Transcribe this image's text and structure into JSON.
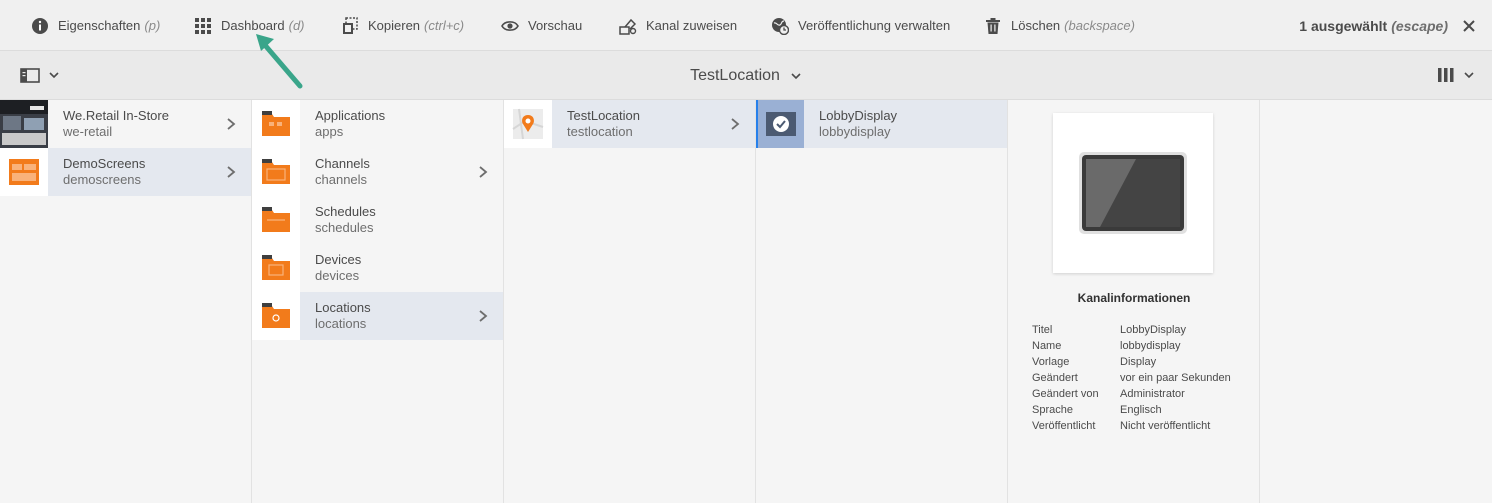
{
  "toolbar": {
    "properties": {
      "label": "Eigenschaften",
      "hint": "(p)"
    },
    "dashboard": {
      "label": "Dashboard",
      "hint": "(d)"
    },
    "copy": {
      "label": "Kopieren",
      "hint": "(ctrl+c)"
    },
    "preview": {
      "label": "Vorschau"
    },
    "assign_channel": {
      "label": "Kanal zuweisen"
    },
    "manage_publication": {
      "label": "Veröffentlichung verwalten"
    },
    "delete": {
      "label": "Löschen",
      "hint": "(backspace)"
    },
    "selection": {
      "label": "1 ausgewählt",
      "hint": "(escape)"
    }
  },
  "title": "TestLocation",
  "columns": {
    "col1": [
      {
        "title": "We.Retail In-Store",
        "sub": "we-retail"
      },
      {
        "title": "DemoScreens",
        "sub": "demoscreens"
      }
    ],
    "col2": [
      {
        "title": "Applications",
        "sub": "apps"
      },
      {
        "title": "Channels",
        "sub": "channels"
      },
      {
        "title": "Schedules",
        "sub": "schedules"
      },
      {
        "title": "Devices",
        "sub": "devices"
      },
      {
        "title": "Locations",
        "sub": "locations"
      }
    ],
    "col3": [
      {
        "title": "TestLocation",
        "sub": "testlocation"
      }
    ],
    "col4": [
      {
        "title": "LobbyDisplay",
        "sub": "lobbydisplay"
      }
    ]
  },
  "detail": {
    "heading": "Kanalinformationen",
    "props": [
      {
        "k": "Titel",
        "v": "LobbyDisplay"
      },
      {
        "k": "Name",
        "v": "lobbydisplay"
      },
      {
        "k": "Vorlage",
        "v": "Display"
      },
      {
        "k": "Geändert",
        "v": "vor ein paar Sekunden"
      },
      {
        "k": "Geändert von",
        "v": "Administrator"
      },
      {
        "k": "Sprache",
        "v": "Englisch"
      },
      {
        "k": "Veröffentlicht",
        "v": "Nicht veröffentlicht"
      }
    ]
  },
  "colors": {
    "accent": "#2680eb",
    "folder": "#f27b1b",
    "annotation_arrow": "#3aa58a"
  }
}
